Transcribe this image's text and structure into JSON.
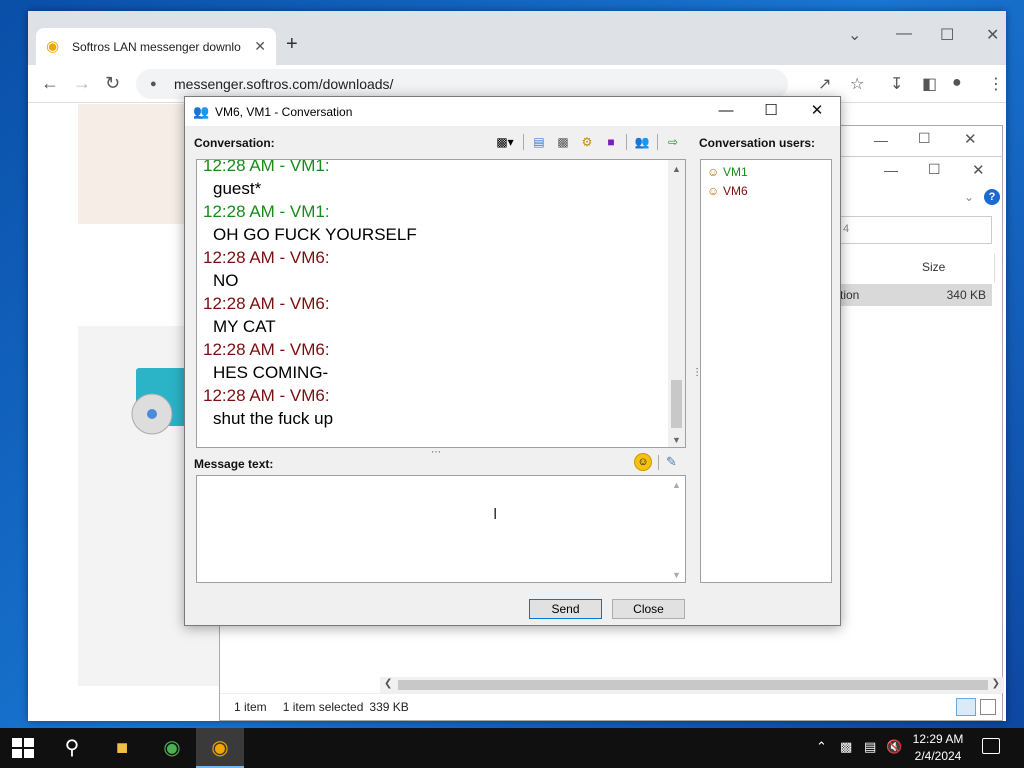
{
  "browser": {
    "tab_title": "Softros LAN messenger downlo",
    "url": "messenger.softros.com/downloads/"
  },
  "explorer": {
    "column_size": "Size",
    "row_name": "tion",
    "row_size": "340 KB",
    "search_text": "4",
    "status_items": "1 item",
    "status_selected": "1 item selected",
    "status_size": "339 KB"
  },
  "dialog": {
    "title": "VM6, VM1 - Conversation",
    "conversation_label": "Conversation:",
    "users_label": "Conversation users:",
    "message_label": "Message text:",
    "send_label": "Send",
    "close_label": "Close",
    "messages": [
      {
        "sender": "12:28 AM - VM1:",
        "from": "vm1",
        "text": "guest*"
      },
      {
        "sender": "12:28 AM - VM1:",
        "from": "vm1",
        "text": "OH GO FUCK YOURSELF"
      },
      {
        "sender": "12:28 AM - VM6:",
        "from": "vm6",
        "text": "NO"
      },
      {
        "sender": "12:28 AM - VM6:",
        "from": "vm6",
        "text": "MY CAT"
      },
      {
        "sender": "12:28 AM - VM6:",
        "from": "vm6",
        "text": "HES COMING-"
      },
      {
        "sender": "12:28 AM - VM6:",
        "from": "vm6",
        "text": "shut the fuck up"
      }
    ],
    "users": [
      {
        "name": "VM1",
        "kind": "vm1"
      },
      {
        "name": "VM6",
        "kind": "vm6"
      }
    ]
  },
  "taskbar": {
    "time": "12:29 AM",
    "date": "2/4/2024"
  },
  "colors": {
    "vm1": "#1a8a1a",
    "vm6": "#7a0f0f",
    "accent": "#0078d7"
  }
}
